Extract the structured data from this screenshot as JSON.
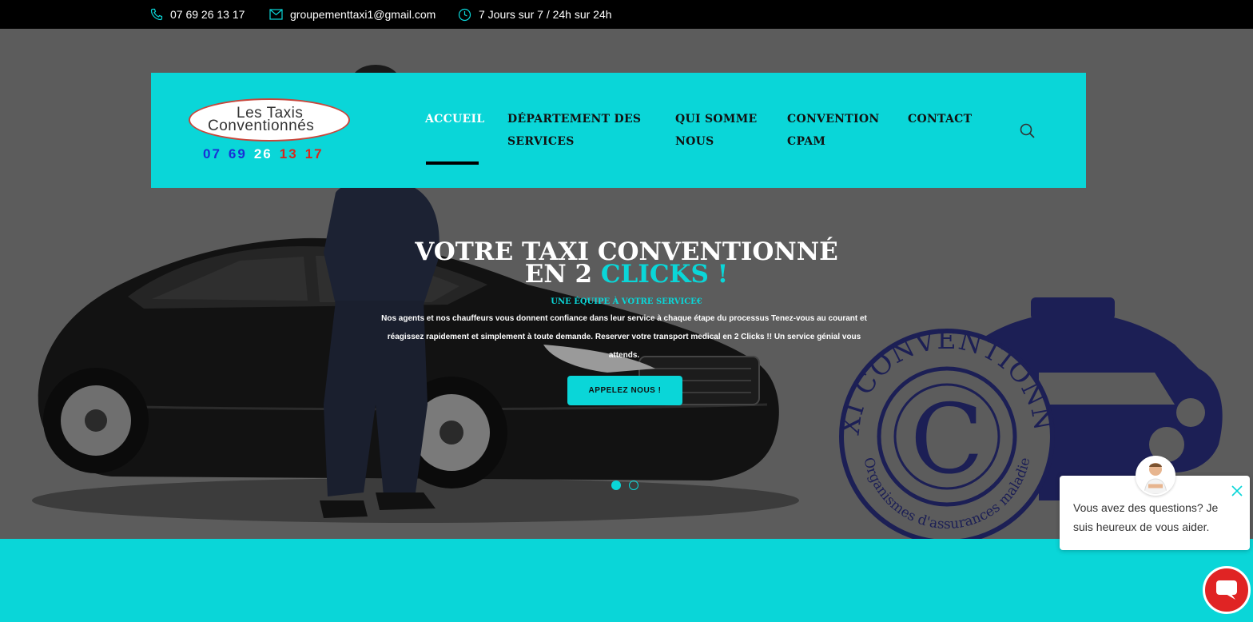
{
  "topbar": {
    "phone": "07 69 26 13 17",
    "email": "groupementtaxi1@gmail.com",
    "hours": "7 Jours sur 7 / 24h sur 24h",
    "icons": [
      "phone-icon",
      "mail-icon",
      "clock-icon"
    ]
  },
  "logo": {
    "line1": "Les Taxis",
    "line2": "Conventionnés",
    "phone_parts": [
      {
        "text": "07",
        "color": "#1a2fd6"
      },
      {
        "text": "69",
        "color": "#1a2fd6"
      },
      {
        "text": "26",
        "color": "#ffffff"
      },
      {
        "text": "13",
        "color": "#d9261c"
      },
      {
        "text": "17",
        "color": "#d9261c"
      }
    ]
  },
  "nav": {
    "items": [
      {
        "line1": "ACCUEIL",
        "line2": "",
        "active": true
      },
      {
        "line1": "DÉPARTEMENT DES",
        "line2": "SERVICES",
        "active": false
      },
      {
        "line1": "QUI SOMME",
        "line2": "NOUS",
        "active": false
      },
      {
        "line1": "CONVENTION",
        "line2": "CPAM",
        "active": false
      },
      {
        "line1": "CONTACT",
        "line2": "",
        "active": false
      }
    ],
    "search_icon": "search-icon"
  },
  "hero": {
    "title_line1": "VOTRE TAXI CONVENTIONNÉ",
    "title_line2_prefix": "EN 2 ",
    "title_line2_accent": "CLICKS !",
    "subtitle": "UNE ÉQUIPE À VOTRE SERVICE€",
    "description": "Nos agents et nos chauffeurs vous donnent confiance dans leur service à chaque étape du processus Tenez-vous au courant et réagissez rapidement et simplement à toute demande. Reserver votre transport medical en 2 Clicks !! Un service génial vous attends.",
    "cta_label": "APPELEZ NOUS !",
    "slides": [
      true,
      false
    ],
    "badge": {
      "ring_top": "TAXI CONVENTIONNÉE",
      "letter": "C",
      "ring_bottom": "Organismes d'assurances maladie"
    }
  },
  "chat": {
    "message": "Vous avez des questions? Je suis heureux de vous aider.",
    "close_icon": "close-icon",
    "launcher_icon": "chat-bubble-icon"
  },
  "colors": {
    "accent": "#0ad6d8",
    "topbar": "#000000",
    "hero_bg": "#5c5c5c",
    "badge_navy": "#1c1f55",
    "chat_red": "#e02424"
  }
}
